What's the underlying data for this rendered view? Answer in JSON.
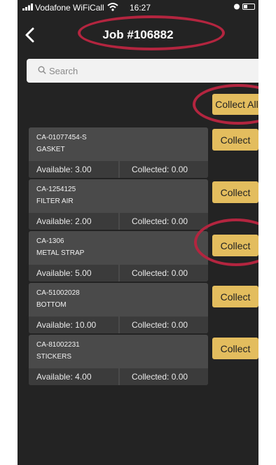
{
  "status_bar": {
    "carrier": "Vodafone WiFiCall",
    "time": "16:27"
  },
  "header": {
    "back_icon": "chevron-left-icon",
    "title": "Job #106882"
  },
  "search": {
    "placeholder": "Search",
    "value": ""
  },
  "actions": {
    "collect_all_label": "Collect All"
  },
  "items": [
    {
      "code": "CA-01077454-S",
      "name": "GASKET",
      "available": "Available: 3.00",
      "collected": "Collected: 0.00",
      "button": "Collect"
    },
    {
      "code": "CA-1254125",
      "name": "FILTER AIR",
      "available": "Available: 2.00",
      "collected": "Collected: 0.00",
      "button": "Collect"
    },
    {
      "code": "CA-1306",
      "name": "METAL STRAP",
      "available": "Available: 5.00",
      "collected": "Collected: 0.00",
      "button": "Collect"
    },
    {
      "code": "CA-51002028",
      "name": "BOTTOM",
      "available": "Available: 10.00",
      "collected": "Collected: 0.00",
      "button": "Collect"
    },
    {
      "code": "CA-81002231",
      "name": "STICKERS",
      "available": "Available: 4.00",
      "collected": "Collected: 0.00",
      "button": "Collect"
    }
  ],
  "colors": {
    "background": "#232323",
    "card": "#4a4a4a",
    "button": "#e3bd5e",
    "annotation": "#b3253f"
  }
}
